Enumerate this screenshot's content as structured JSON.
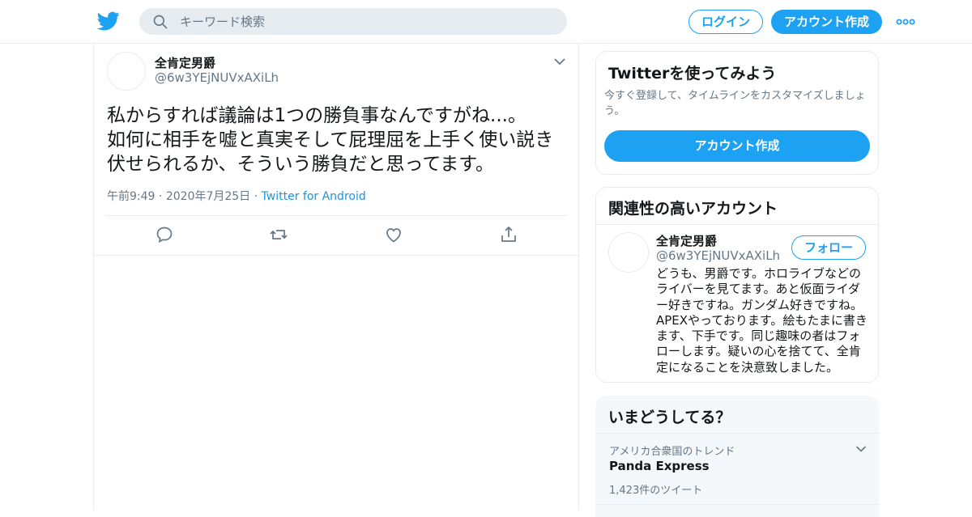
{
  "colors": {
    "accent": "#1da1f2",
    "link": "#1b95e0",
    "secondary_text": "#657786",
    "border": "#e6ecf0"
  },
  "header": {
    "search_placeholder": "キーワード検索",
    "login_label": "ログイン",
    "signup_label": "アカウント作成"
  },
  "tweet": {
    "display_name": "全肯定男爵",
    "handle": "@6w3YEjNUVxAXiLh",
    "text": "私からすれば議論は1つの勝負事なんですがね...。\n如何に相手を嘘と真実そして屁理屈を上手く使い説き伏せられるか、そういう勝負だと思ってます。",
    "time": "午前9:49",
    "date": "2020年7月25日",
    "source": "Twitter for Android"
  },
  "signup_card": {
    "title": "Twitterを使ってみよう",
    "subtitle": "今すぐ登録して、タイムラインをカスタマイズしましょう。",
    "button_label": "アカウント作成"
  },
  "related": {
    "title": "関連性の高いアカウント",
    "account": {
      "display_name": "全肯定男爵",
      "handle": "@6w3YEjNUVxAXiLh",
      "follow_label": "フォロー",
      "bio": "どうも、男爵です。ホロライブなどのライバーを見てます。あと仮面ライダー好きですね。ガンダム好きですね。APEXやっております。絵もたまに書きます、下手です。同じ趣味の者はフォローします。疑いの心を捨てて、全肯定になることを決意致しました。"
    }
  },
  "trends": {
    "title": "いまどうしてる？",
    "items": [
      {
        "location": "アメリカ合衆国のトレンド",
        "name": "Panda Express",
        "count": "1,423件のツイート"
      }
    ]
  }
}
